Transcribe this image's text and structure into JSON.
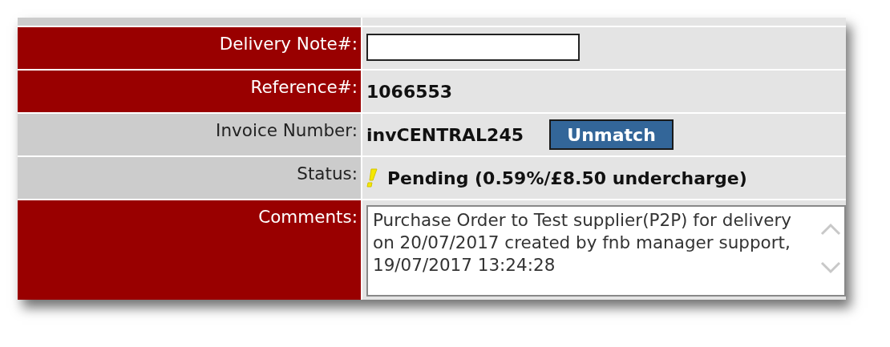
{
  "rows": [
    {
      "label": "Delivery Note#:",
      "required": true,
      "kind": "input",
      "value": ""
    },
    {
      "label": "Reference#:",
      "required": true,
      "kind": "text",
      "value": "1066553"
    },
    {
      "label": "Invoice Number:",
      "required": false,
      "kind": "invoice",
      "value": "invCENTRAL245",
      "button": "Unmatch"
    },
    {
      "label": "Status:",
      "required": false,
      "kind": "status",
      "warning": true,
      "value": "Pending (0.59%/£8.50 undercharge)"
    },
    {
      "label": "Comments:",
      "required": true,
      "kind": "textarea",
      "value": "Purchase Order to Test supplier(P2P) for delivery on 20/07/2017 created by fnb manager support, 19/07/2017 13:24:28"
    }
  ]
}
